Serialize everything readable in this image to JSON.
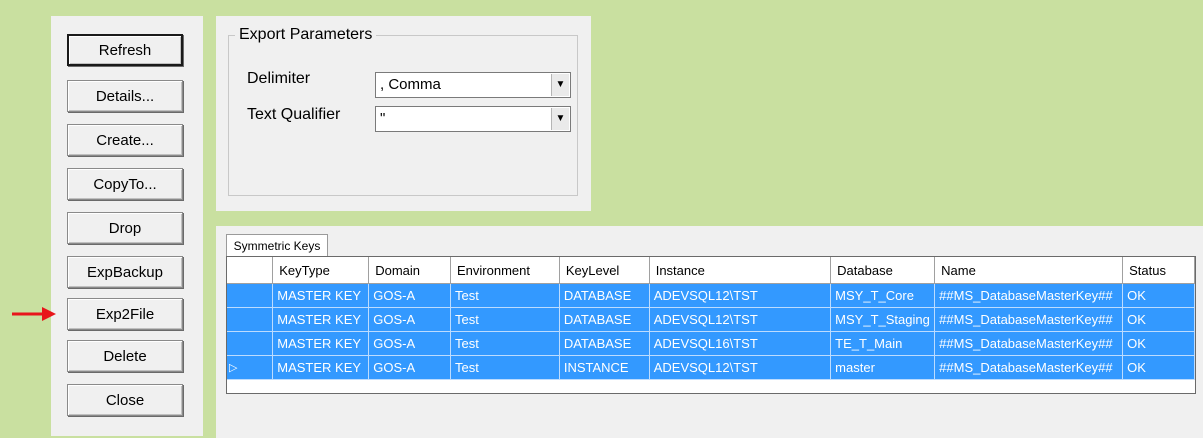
{
  "buttons": {
    "refresh": "Refresh",
    "details": "Details...",
    "create": "Create...",
    "copyto": "CopyTo...",
    "drop": "Drop",
    "expbackup": "ExpBackup",
    "exp2file": "Exp2File",
    "delete": "Delete",
    "close": "Close"
  },
  "export_parameters": {
    "title": "Export Parameters",
    "delimiter_label": "Delimiter",
    "delimiter_value": ", Comma",
    "text_qualifier_label": "Text Qualifier",
    "text_qualifier_value": "\""
  },
  "grid": {
    "tab_label": "Symmetric Keys",
    "columns": [
      "KeyType",
      "Domain",
      "Environment",
      "KeyLevel",
      "Instance",
      "Database",
      "Name",
      "Status"
    ],
    "rows": [
      [
        "MASTER KEY",
        "GOS-A",
        "Test",
        "DATABASE",
        "ADEVSQL12\\TST",
        "MSY_T_Core",
        "##MS_DatabaseMasterKey##",
        "OK"
      ],
      [
        "MASTER KEY",
        "GOS-A",
        "Test",
        "DATABASE",
        "ADEVSQL12\\TST",
        "MSY_T_Staging",
        "##MS_DatabaseMasterKey##",
        "OK"
      ],
      [
        "MASTER KEY",
        "GOS-A",
        "Test",
        "DATABASE",
        "ADEVSQL16\\TST",
        "TE_T_Main",
        "##MS_DatabaseMasterKey##",
        "OK"
      ],
      [
        "MASTER KEY",
        "GOS-A",
        "Test",
        "INSTANCE",
        "ADEVSQL12\\TST",
        "master",
        "##MS_DatabaseMasterKey##",
        "OK"
      ]
    ],
    "current_row_marker": "▷"
  },
  "colors": {
    "background": "#c9e0a0",
    "selection": "#3399ff",
    "arrow": "#e8151b"
  },
  "icons": {
    "annotation": "red-arrow-icon",
    "combo": "chevron-down-icon"
  }
}
